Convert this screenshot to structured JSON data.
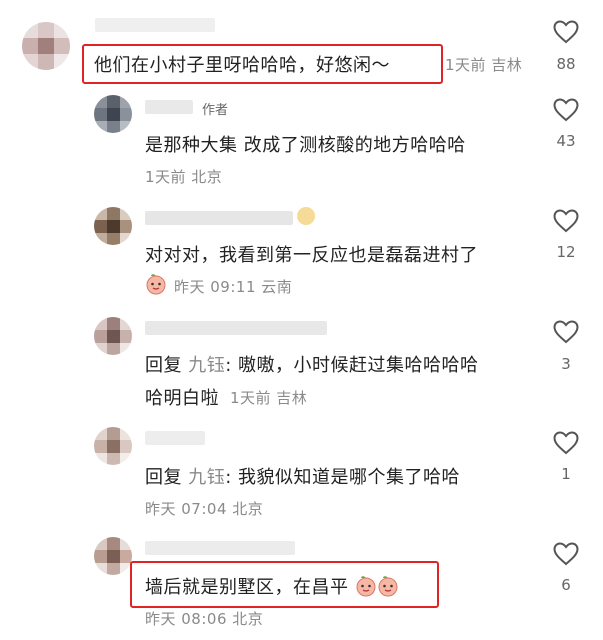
{
  "comments": [
    {
      "text": "他们在小村子里呀哈哈哈，好悠闲～",
      "meta": "1天前 吉林",
      "likes": "88"
    },
    {
      "author_tag": "作者",
      "text": "是那种大集 改成了测核酸的地方哈哈哈",
      "meta": "1天前 北京",
      "likes": "43"
    },
    {
      "text": "对对对，我看到第一反应也是磊磊进村了",
      "meta": "昨天 09:11 云南",
      "likes": "12"
    },
    {
      "reply_prefix": "回复",
      "reply_to": "九钰",
      "text_line1": ": 嗷嗷，小时候赶过集哈哈哈哈",
      "text_line2": "哈明白啦",
      "meta": "1天前 吉林",
      "likes": "3"
    },
    {
      "reply_prefix": "回复",
      "reply_to": "九钰",
      "text": ": 我貌似知道是哪个集了哈哈",
      "meta": "昨天 07:04 北京",
      "likes": "1"
    },
    {
      "text": "墙后就是别墅区，在昌平",
      "meta": "昨天 08:06 北京",
      "likes": "6"
    }
  ],
  "colors": {
    "highlight": "#e02424",
    "meta": "#8a8a8a",
    "text": "#222222"
  },
  "icons": {
    "like": "heart-outline-icon",
    "emoji": "peach-emoji-icon"
  }
}
